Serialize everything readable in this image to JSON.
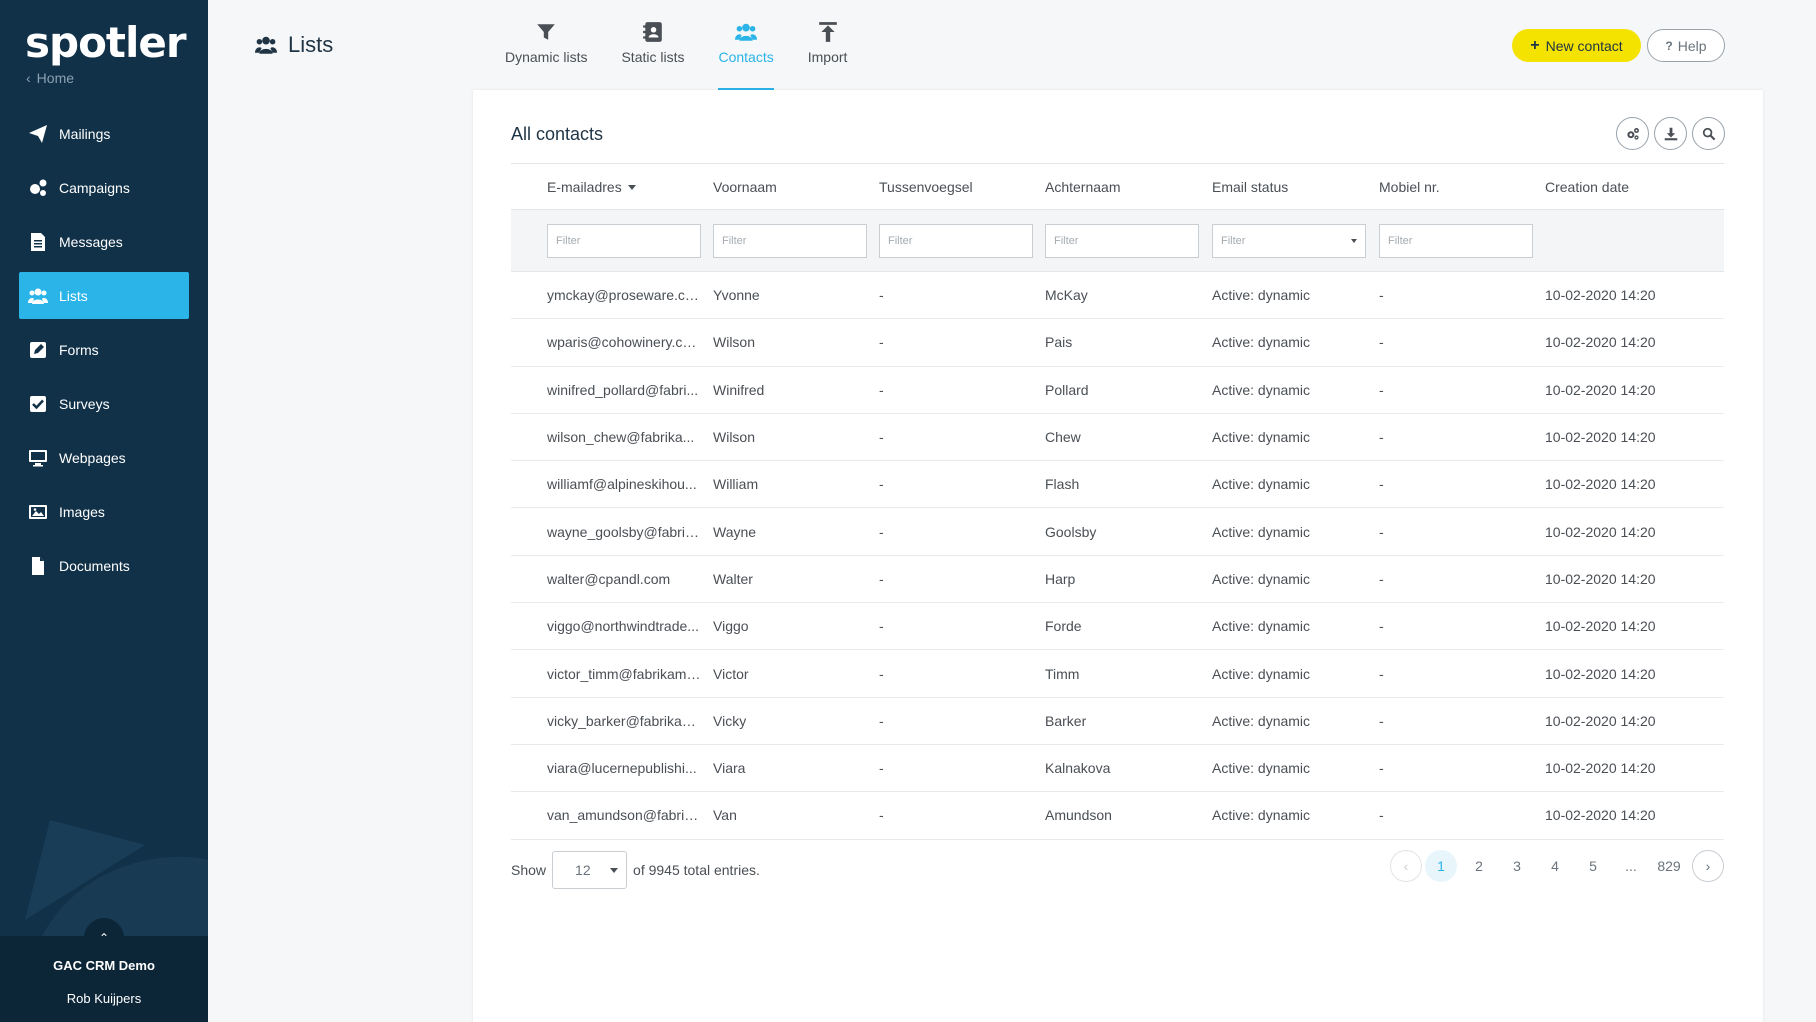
{
  "sidebar": {
    "logo": "spotler",
    "home": "Home",
    "items": [
      {
        "label": "Mailings",
        "icon": "paper-plane-icon"
      },
      {
        "label": "Campaigns",
        "icon": "cogs-icon"
      },
      {
        "label": "Messages",
        "icon": "document-icon"
      },
      {
        "label": "Lists",
        "icon": "users-icon",
        "active": true
      },
      {
        "label": "Forms",
        "icon": "edit-icon"
      },
      {
        "label": "Surveys",
        "icon": "checkbox-icon"
      },
      {
        "label": "Webpages",
        "icon": "monitor-icon"
      },
      {
        "label": "Images",
        "icon": "image-icon"
      },
      {
        "label": "Documents",
        "icon": "file-icon"
      }
    ],
    "account": "GAC CRM Demo",
    "user": "Rob Kuijpers"
  },
  "header": {
    "title": "Lists",
    "tabs": [
      {
        "label": "Dynamic lists",
        "icon": "filter-icon"
      },
      {
        "label": "Static lists",
        "icon": "address-book-icon"
      },
      {
        "label": "Contacts",
        "icon": "users-icon",
        "active": true
      },
      {
        "label": "Import",
        "icon": "upload-icon"
      }
    ],
    "new_contact": "New contact",
    "help": "Help"
  },
  "card": {
    "title": "All contacts",
    "tools": [
      "cogs-icon",
      "download-icon",
      "search-icon"
    ]
  },
  "table": {
    "columns": [
      "E-mailadres",
      "Voornaam",
      "Tussenvoegsel",
      "Achternaam",
      "Email status",
      "Mobiel nr.",
      "Creation date"
    ],
    "filter_placeholder": "Filter",
    "rows": [
      [
        "ymckay@proseware.com",
        "Yvonne",
        "-",
        "McKay",
        "Active: dynamic",
        "-",
        "10-02-2020 14:20"
      ],
      [
        "wparis@cohowinery.co...",
        "Wilson",
        "-",
        "Pais",
        "Active: dynamic",
        "-",
        "10-02-2020 14:20"
      ],
      [
        "winifred_pollard@fabri...",
        "Winifred",
        "-",
        "Pollard",
        "Active: dynamic",
        "-",
        "10-02-2020 14:20"
      ],
      [
        "wilson_chew@fabrika...",
        "Wilson",
        "-",
        "Chew",
        "Active: dynamic",
        "-",
        "10-02-2020 14:20"
      ],
      [
        "williamf@alpineskihou...",
        "William",
        "-",
        "Flash",
        "Active: dynamic",
        "-",
        "10-02-2020 14:20"
      ],
      [
        "wayne_goolsby@fabrik...",
        "Wayne",
        "-",
        "Goolsby",
        "Active: dynamic",
        "-",
        "10-02-2020 14:20"
      ],
      [
        "walter@cpandl.com",
        "Walter",
        "-",
        "Harp",
        "Active: dynamic",
        "-",
        "10-02-2020 14:20"
      ],
      [
        "viggo@northwindtrade...",
        "Viggo",
        "-",
        "Forde",
        "Active: dynamic",
        "-",
        "10-02-2020 14:20"
      ],
      [
        "victor_timm@fabrikam....",
        "Victor",
        "-",
        "Timm",
        "Active: dynamic",
        "-",
        "10-02-2020 14:20"
      ],
      [
        "vicky_barker@fabrikam...",
        "Vicky",
        "-",
        "Barker",
        "Active: dynamic",
        "-",
        "10-02-2020 14:20"
      ],
      [
        "viara@lucernepublishi...",
        "Viara",
        "-",
        "Kalnakova",
        "Active: dynamic",
        "-",
        "10-02-2020 14:20"
      ],
      [
        "van_amundson@fabrik...",
        "Van",
        "-",
        "Amundson",
        "Active: dynamic",
        "-",
        "10-02-2020 14:20"
      ]
    ]
  },
  "footer": {
    "show_label": "Show",
    "page_size": "12",
    "total_text": "of 9945 total entries.",
    "pages": [
      "1",
      "2",
      "3",
      "4",
      "5",
      "...",
      "829"
    ],
    "prev": "‹",
    "next": "›"
  },
  "colors": {
    "sidebar": "#113148",
    "accent": "#2ab4e8",
    "primary_button": "#f4e200"
  }
}
